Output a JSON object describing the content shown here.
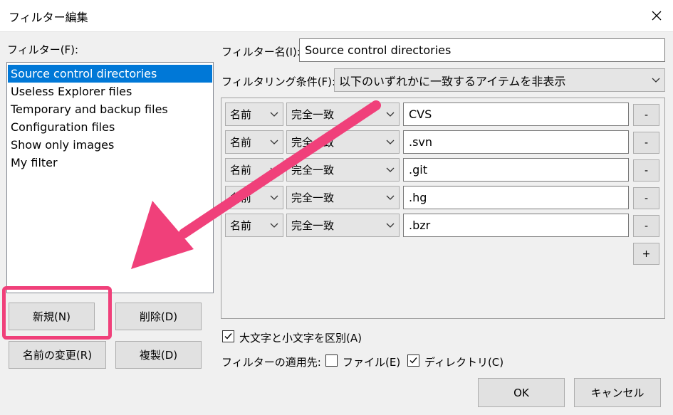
{
  "window": {
    "title": "フィルター編集"
  },
  "left": {
    "filters_label": "フィルター(F):",
    "items": [
      {
        "label": "Source control directories",
        "selected": true
      },
      {
        "label": "Useless Explorer files",
        "selected": false
      },
      {
        "label": "Temporary and backup files",
        "selected": false
      },
      {
        "label": "Configuration files",
        "selected": false
      },
      {
        "label": "Show only images",
        "selected": false
      },
      {
        "label": "My filter",
        "selected": false
      }
    ],
    "new_label": "新規(N)",
    "delete_label": "削除(D)",
    "rename_label": "名前の変更(R)",
    "copy_label": "複製(D)"
  },
  "right": {
    "name_label": "フィルター名(I):",
    "name_value": "Source control directories",
    "condition_label": "フィルタリング条件(F):",
    "condition_value": "以下のいずれかに一致するアイテムを非表示",
    "rules": [
      {
        "field": "名前",
        "match": "完全一致",
        "value": "CVS"
      },
      {
        "field": "名前",
        "match": "完全一致",
        "value": ".svn"
      },
      {
        "field": "名前",
        "match": "完全一致",
        "value": ".git"
      },
      {
        "field": "名前",
        "match": "完全一致",
        "value": ".hg"
      },
      {
        "field": "名前",
        "match": "完全一致",
        "value": ".bzr"
      }
    ],
    "remove_label": "-",
    "add_label": "+",
    "case_label": "大文字と小文字を区別(A)",
    "case_checked": true,
    "apply_to_label": "フィルターの適用先:",
    "files_label": "ファイル(E)",
    "files_checked": false,
    "dirs_label": "ディレクトリ(C)",
    "dirs_checked": true
  },
  "footer": {
    "ok_label": "OK",
    "cancel_label": "キャンセル"
  },
  "annotation": {
    "color": "#f0407a"
  }
}
